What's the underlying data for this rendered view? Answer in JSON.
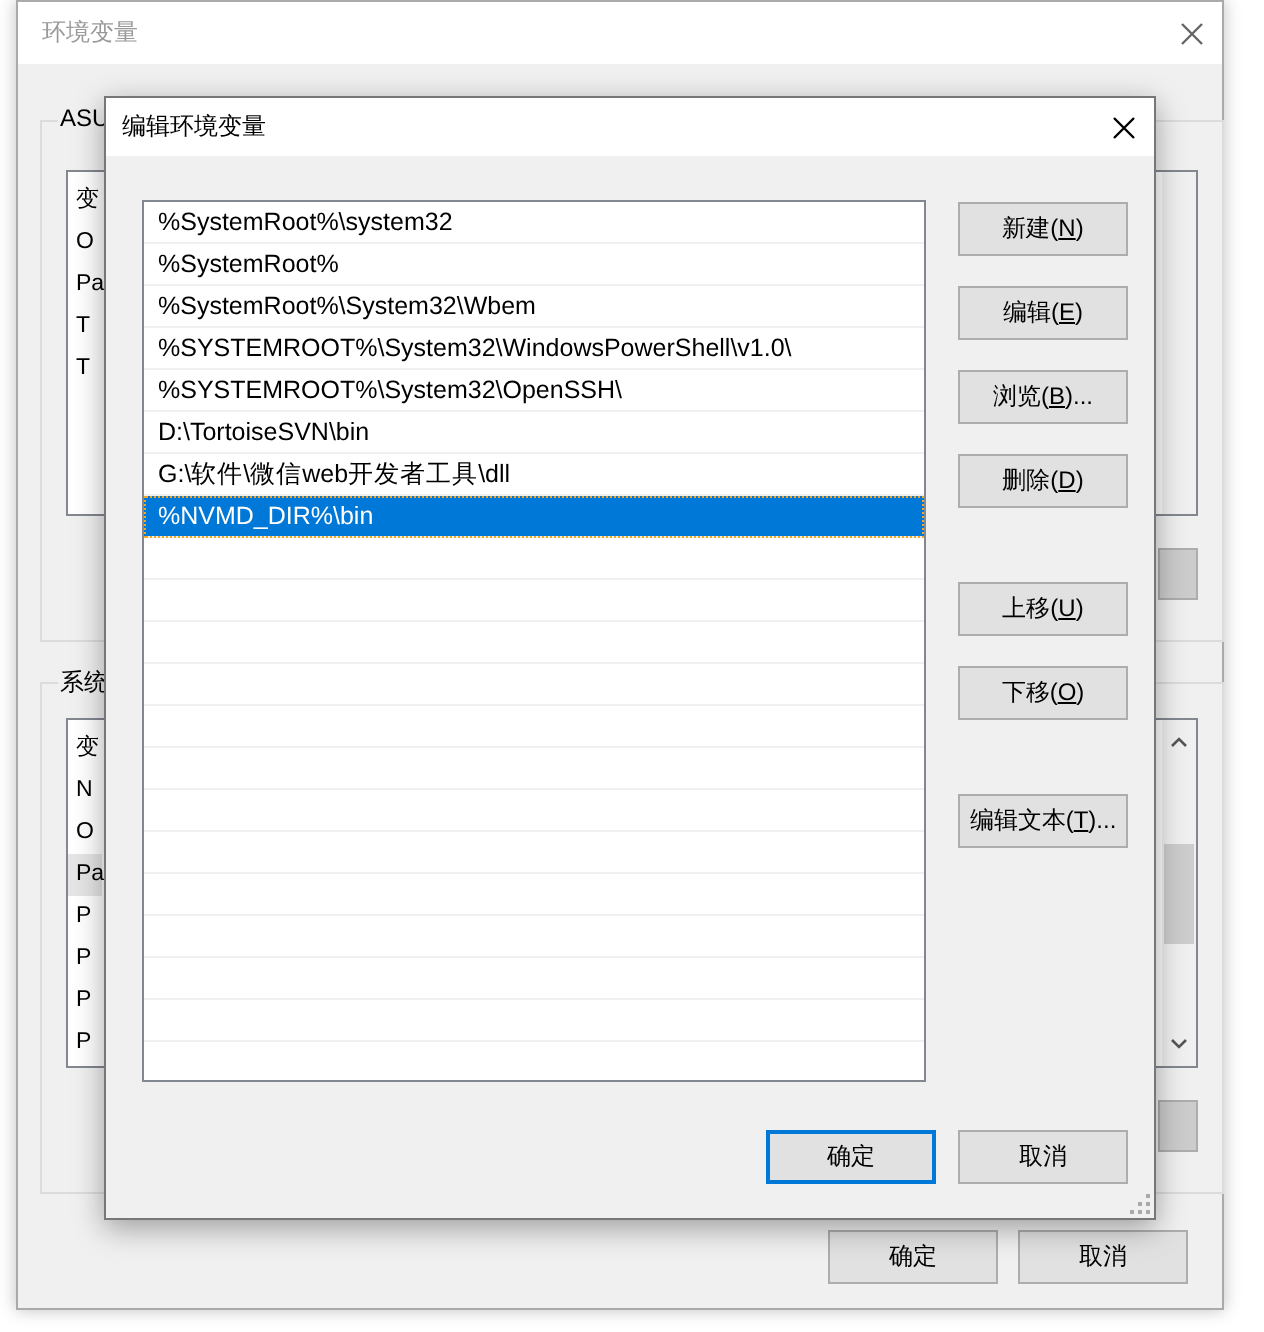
{
  "background_window": {
    "title": "环境变量",
    "user_group": {
      "title": "ASU",
      "rows": [
        {
          "text": "变",
          "selected": false
        },
        {
          "text": "O",
          "selected": false
        },
        {
          "text": "Pa",
          "selected": false
        },
        {
          "text": "T",
          "selected": false
        },
        {
          "text": "T",
          "selected": false
        }
      ]
    },
    "system_group": {
      "title": "系统",
      "rows": [
        {
          "text": "变",
          "selected": false
        },
        {
          "text": "N",
          "selected": false
        },
        {
          "text": "O",
          "selected": false
        },
        {
          "text": "Pa",
          "selected": true
        },
        {
          "text": "P",
          "selected": false
        },
        {
          "text": "P",
          "selected": false
        },
        {
          "text": "P",
          "selected": false
        },
        {
          "text": "P",
          "selected": false
        }
      ]
    },
    "buttons": [
      {
        "label": "确定"
      },
      {
        "label": "取消"
      }
    ]
  },
  "dialog": {
    "title": "编辑环境变量",
    "paths": [
      {
        "text": "%SystemRoot%\\system32",
        "selected": false
      },
      {
        "text": "%SystemRoot%",
        "selected": false
      },
      {
        "text": "%SystemRoot%\\System32\\Wbem",
        "selected": false
      },
      {
        "text": "%SYSTEMROOT%\\System32\\WindowsPowerShell\\v1.0\\",
        "selected": false
      },
      {
        "text": "%SYSTEMROOT%\\System32\\OpenSSH\\",
        "selected": false
      },
      {
        "text": "D:\\TortoiseSVN\\bin",
        "selected": false
      },
      {
        "text": "G:\\软件\\微信web开发者工具\\dll",
        "selected": false
      },
      {
        "text": "%NVMD_DIR%\\bin",
        "selected": true
      }
    ],
    "button_groups": [
      [
        {
          "label": "新建(",
          "access_key": "N",
          "label_end": ")"
        },
        {
          "label": "编辑(",
          "access_key": "E",
          "label_end": ")"
        },
        {
          "label": "浏览(",
          "access_key": "B",
          "label_end": ")..."
        },
        {
          "label": "删除(",
          "access_key": "D",
          "label_end": ")"
        }
      ],
      [
        {
          "label": "上移(",
          "access_key": "U",
          "label_end": ")"
        },
        {
          "label": "下移(",
          "access_key": "O",
          "label_end": ")"
        }
      ],
      [
        {
          "label": "编辑文本(",
          "access_key": "T",
          "label_end": ")..."
        }
      ]
    ],
    "buttons": [
      {
        "label": "确定",
        "default": true
      },
      {
        "label": "取消",
        "default": false
      }
    ]
  }
}
